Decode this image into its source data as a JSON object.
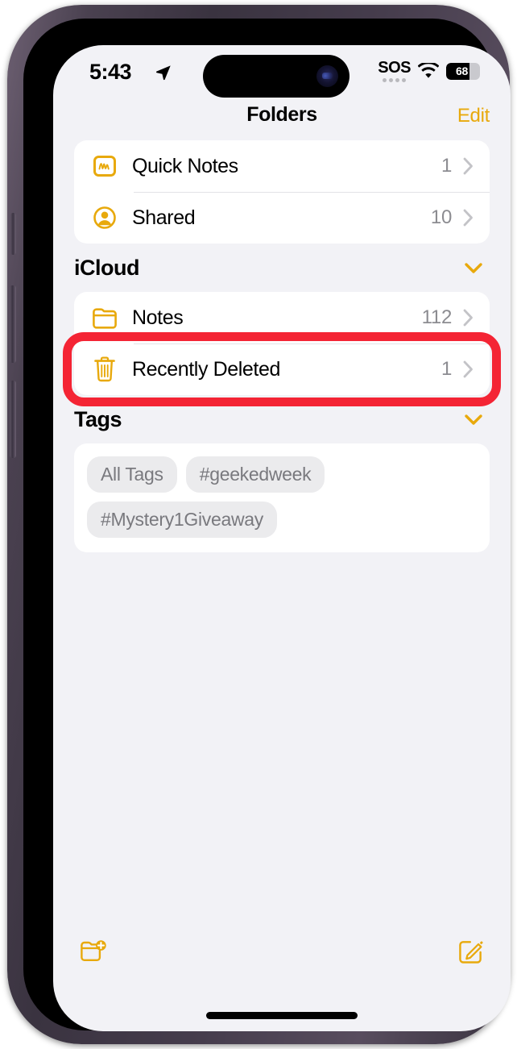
{
  "status_bar": {
    "time": "5:43",
    "location_icon": "location-arrow-icon",
    "sos_label": "SOS",
    "wifi_icon": "wifi-icon",
    "battery_percent": "68",
    "battery_level": 68
  },
  "nav": {
    "title": "Folders",
    "edit_label": "Edit"
  },
  "top_folders": [
    {
      "label": "Quick Notes",
      "count": "1",
      "icon": "quick-note-icon"
    },
    {
      "label": "Shared",
      "count": "10",
      "icon": "shared-person-icon"
    }
  ],
  "icloud_section": {
    "title": "iCloud",
    "collapse_icon": "chevron-down-icon",
    "items": [
      {
        "label": "Notes",
        "count": "112",
        "icon": "folder-icon"
      },
      {
        "label": "Recently Deleted",
        "count": "1",
        "icon": "trash-icon"
      }
    ]
  },
  "tags_section": {
    "title": "Tags",
    "collapse_icon": "chevron-down-icon",
    "chips": [
      {
        "label": "All Tags"
      },
      {
        "label": "#geekedweek"
      },
      {
        "label": "#Mystery1Giveaway"
      }
    ]
  },
  "toolbar": {
    "new_folder_icon": "new-folder-icon",
    "compose_icon": "compose-note-icon"
  },
  "annotation": {
    "target": "Recently Deleted",
    "color": "#f42434"
  },
  "colors": {
    "accent_yellow": "#e8a90c",
    "annotation_red": "#f42434",
    "screen_background": "#f2f2f6",
    "card_background": "#ffffff"
  }
}
